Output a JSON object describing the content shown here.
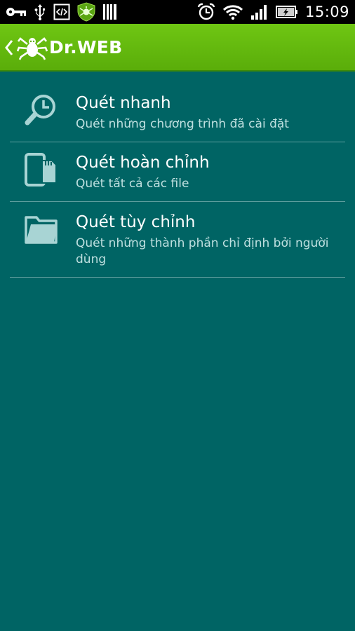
{
  "status_bar": {
    "time": "15:09",
    "icons_left": [
      "key-icon",
      "usb-icon",
      "code-icon",
      "drweb-shield-icon",
      "barcode-icon"
    ],
    "icons_right": [
      "alarm-icon",
      "wifi-icon",
      "signal-icon",
      "battery-charging-icon"
    ]
  },
  "app_bar": {
    "title": "Dr.WEB",
    "back_icon": "chevron-left-icon",
    "logo_icon": "drweb-spider-logo"
  },
  "scan_options": [
    {
      "title": "Quét nhanh",
      "subtitle": "Quét những chương trình đã cài đặt",
      "icon": "clock-search-icon"
    },
    {
      "title": "Quét hoàn chỉnh",
      "subtitle": "Quét tất cả các file",
      "icon": "phone-sdcard-icon"
    },
    {
      "title": "Quét tùy chỉnh",
      "subtitle": "Quét những thành phần chỉ định bởi người dùng",
      "icon": "folder-icon"
    }
  ],
  "colors": {
    "background": "#006464",
    "app_bar": "#66bb11",
    "icon_tint": "#a8d4d4",
    "divider": "#5e9e9e"
  }
}
